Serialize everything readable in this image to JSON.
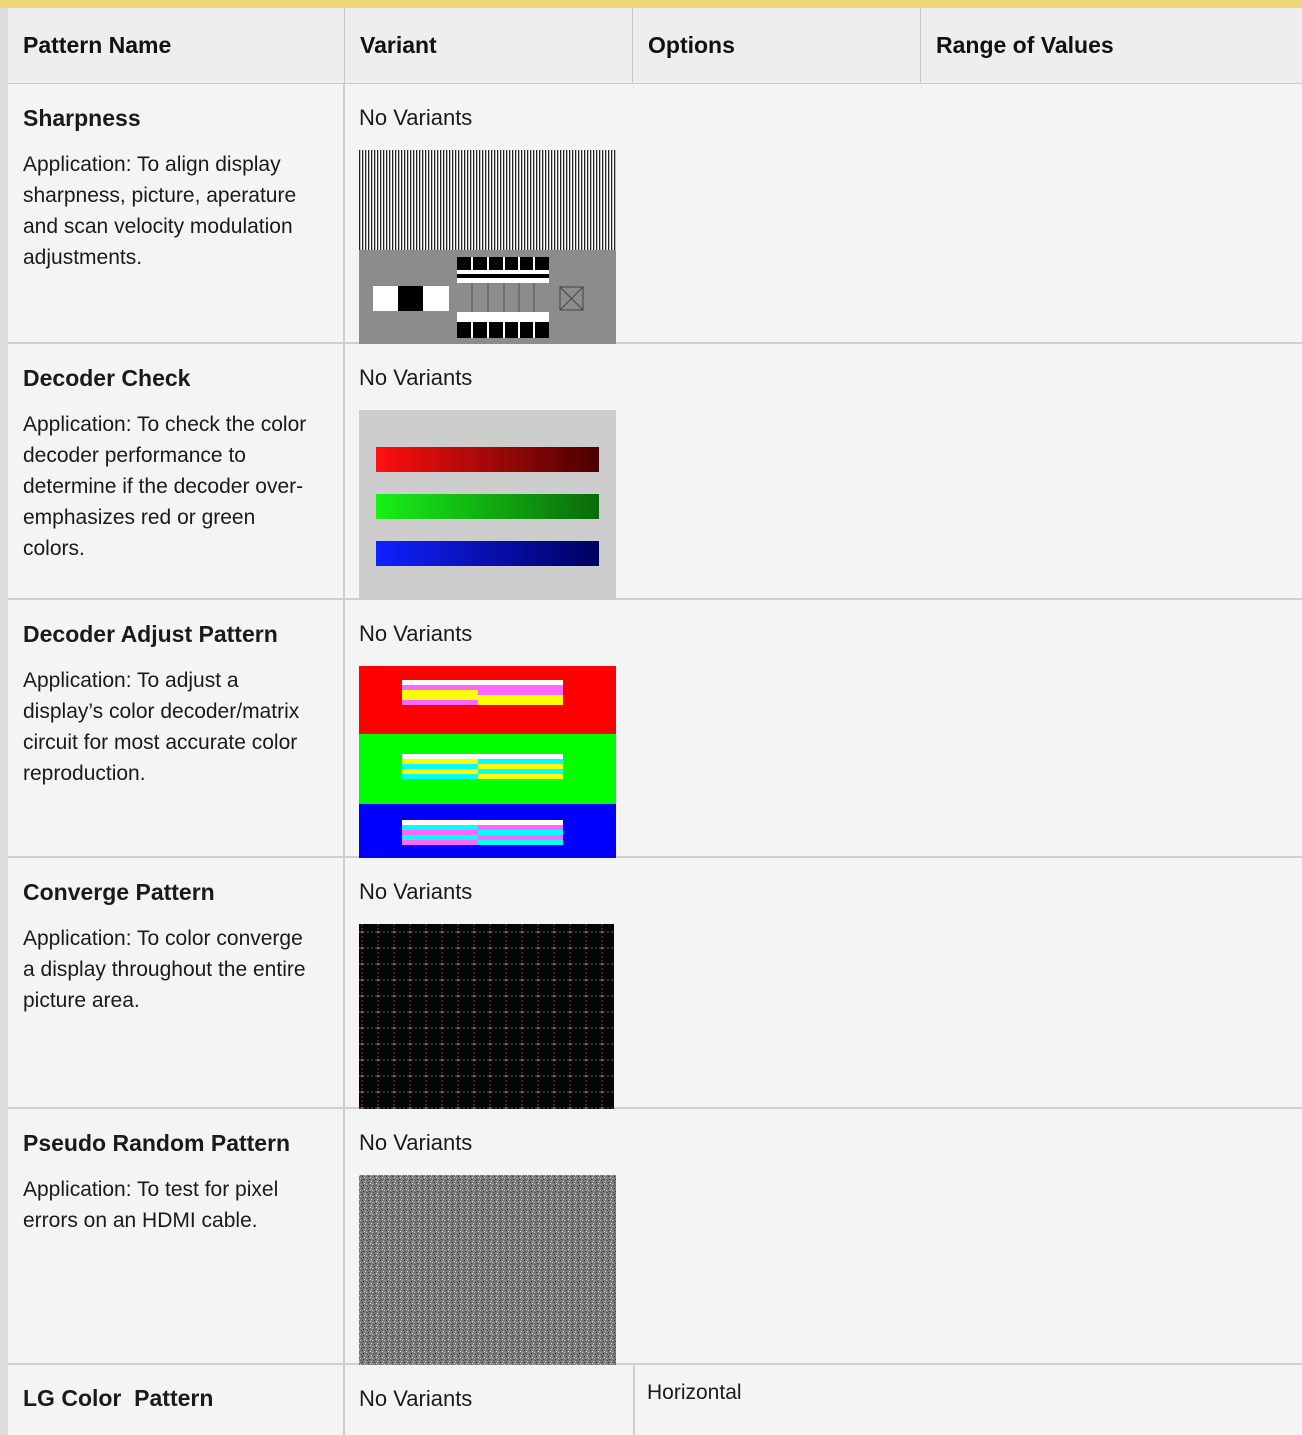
{
  "table": {
    "headers": [
      "Pattern Name",
      "Variant",
      "Options",
      "Range of Values"
    ],
    "rows": [
      {
        "name": "Sharpness",
        "application": "Application: To align display sharpness, picture, aperature and scan velocity modulation adjustments.",
        "variant": "No Variants",
        "image_icon": "sharpness-pattern"
      },
      {
        "name": "Decoder Check",
        "application": "Application: To check the color decoder performance to determine if the decoder over-emphasizes red or green colors.",
        "variant": "No Variants",
        "image_icon": "decoder-check-pattern"
      },
      {
        "name": "Decoder Adjust Pattern",
        "application": "Application: To adjust a display’s color decoder/matrix circuit for most accurate color reproduction.",
        "variant": "No Variants",
        "image_icon": "decoder-adjust-pattern"
      },
      {
        "name": "Converge Pattern",
        "application": "Application: To color converge a display throughout the entire picture area.",
        "variant": "No Variants",
        "image_icon": "converge-pattern"
      },
      {
        "name": "Pseudo Random Pattern",
        "application": "Application: To test for pixel errors on an HDMI cable.",
        "variant": "No Variants",
        "image_icon": "pseudo-random-pattern"
      },
      {
        "name": "LG Color  Pattern",
        "variant": "No Variants",
        "option": "Horizontal"
      }
    ]
  },
  "colors": {
    "header_bg": "#eeeeee",
    "top_accent": "#eed774",
    "row_bg": "#f4f4f4",
    "border": "#cfcfcf"
  }
}
